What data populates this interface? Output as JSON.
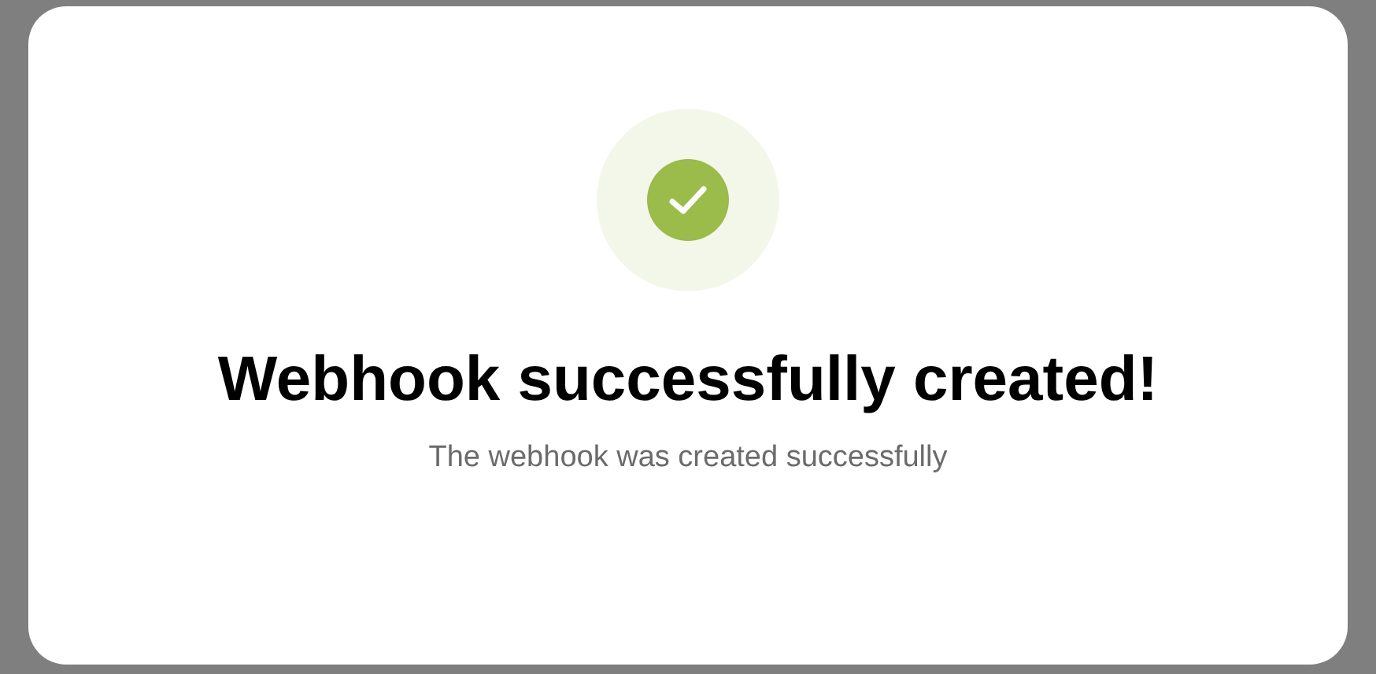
{
  "dialog": {
    "title": "Webhook successfully created!",
    "message": "The webhook was created successfully"
  }
}
